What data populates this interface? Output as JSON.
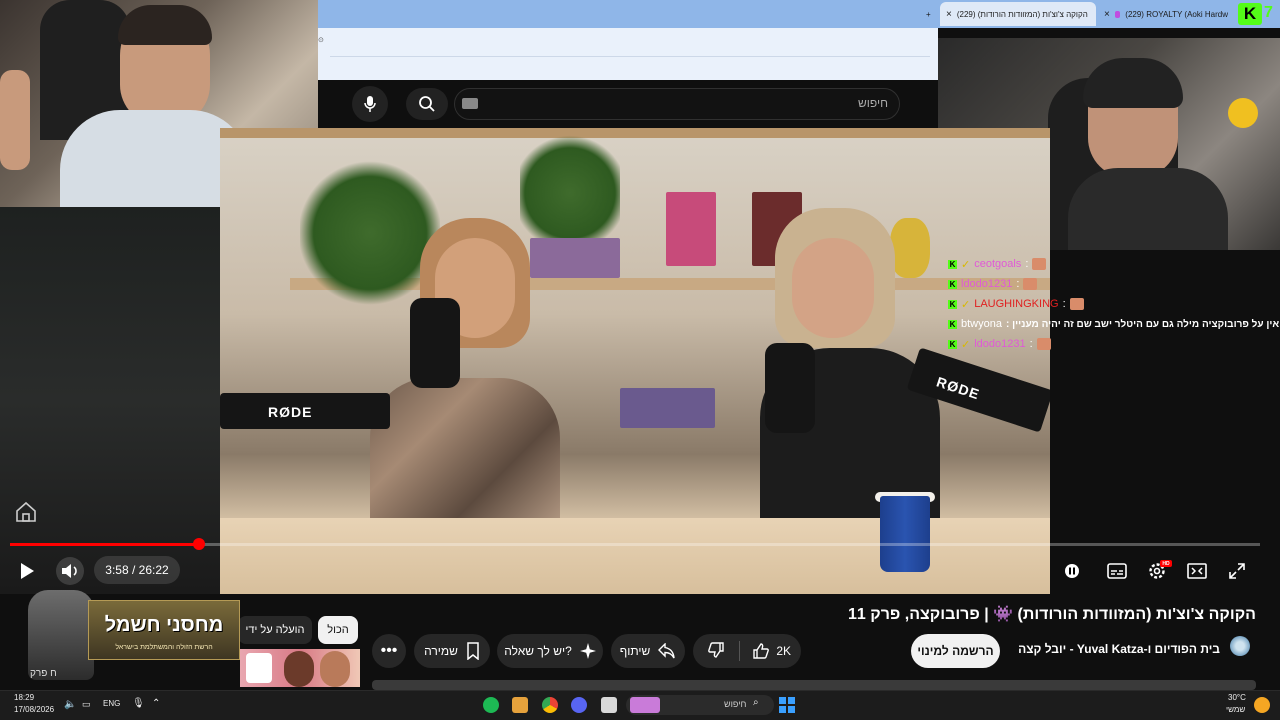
{
  "browser": {
    "tabs": [
      {
        "label": "הקוקה צ'וצ'ות (המזוודות הורודות) (229)",
        "active": true
      },
      {
        "label": "(229) ROYALTY (Aoki Hardw",
        "active": false
      }
    ],
    "new_tab": "+",
    "close": "×",
    "kick_counter": "7"
  },
  "youtube": {
    "search_placeholder": "חיפוש",
    "player": {
      "time": "3:58 / 26:22",
      "progress": 0.151,
      "hd_badge": "HD"
    },
    "video_title": "הקוקה צ'וצ'ות (המזוודות הורודות) 👾 | פרובוקצה, פרק 11",
    "channel": "בית הפודיום ו-Yuval Katza - יובל קצה",
    "subscribe_label": "הרשמה למינוי",
    "likes": "2K",
    "share_label": "שיתוף",
    "ask_label": "יש לך שאלה?",
    "save_label": "שמירה",
    "more_label": "•••",
    "chips": {
      "all": "הכול",
      "uploaded_by": "הועלה על ידי"
    }
  },
  "video_scene": {
    "mic_brand_1": "RØDE",
    "mic_brand_2": "RØDE"
  },
  "chat": [
    {
      "user": "ceotgoals",
      "message": ":",
      "color": "#e05ad6"
    },
    {
      "user": "ldodo1231",
      "message": ":",
      "color": "#e05ad6"
    },
    {
      "user": "LAUGHINGKING",
      "message": ":",
      "color": "#e02020"
    },
    {
      "user": "btwyona",
      "message": ": אין על פרובוקציה מילה גם עם היטלר ישב שם זה יהיה מעניין",
      "color": "#ffffff"
    },
    {
      "user": "ldodo1231",
      "message": ":",
      "color": "#e05ad6"
    }
  ],
  "sponsor": {
    "title": "מחסני חשמל",
    "subtitle": "הרשת הזולה והמשתלמת בישראל"
  },
  "left_panel": {
    "bottom_text": "ח פרק"
  },
  "taskbar": {
    "time": "18:29",
    "date": "17/08/2026",
    "lang": "ENG",
    "search_placeholder": "חיפוש",
    "weather_temp": "30°C",
    "weather_desc": "שמשי"
  },
  "colors": {
    "accent_red": "#ff0000",
    "kick_green": "#53fc18"
  }
}
